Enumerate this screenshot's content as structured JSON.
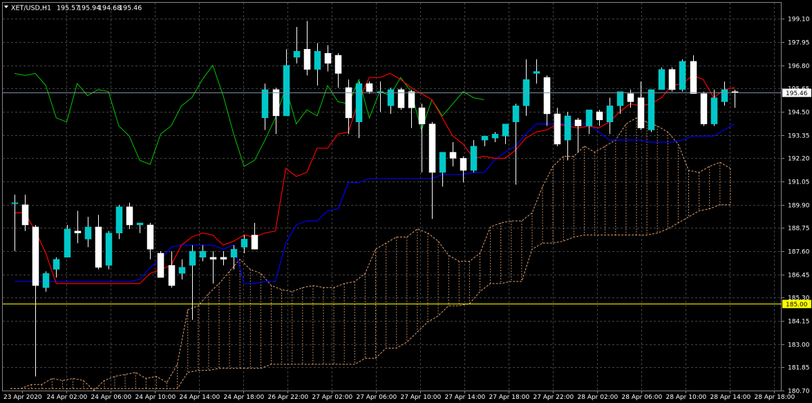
{
  "header": {
    "symbol": "XET/USD,H1",
    "open": "195.57",
    "high": "195.94",
    "low": "194.68",
    "close": "195.46"
  },
  "colors": {
    "background": "#000000",
    "grid": "#444444",
    "bull_candle": "#00c8c8",
    "bear_candle": "#ffffff",
    "tenkan": "#ff0000",
    "kijun": "#0000ff",
    "chikou": "#00c800",
    "cloud": "#e0a070",
    "bid_line": "#7f8fa0",
    "level_line": "#ffff00"
  },
  "chart_data": {
    "type": "candlestick",
    "symbol": "XET/USD",
    "timeframe": "H1",
    "ylim": [
      180.7,
      199.9
    ],
    "y_ticks": [
      "199.10",
      "197.95",
      "196.80",
      "195.65",
      "194.50",
      "193.35",
      "192.20",
      "191.05",
      "189.90",
      "188.75",
      "187.60",
      "186.45",
      "185.30",
      "184.15",
      "183.00",
      "181.85",
      "180.70"
    ],
    "x_ticks": [
      "23 Apr 2020",
      "24 Apr 02:00",
      "24 Apr 06:00",
      "24 Apr 10:00",
      "24 Apr 14:00",
      "24 Apr 18:00",
      "26 Apr 22:00",
      "27 Apr 02:00",
      "27 Apr 06:00",
      "27 Apr 10:00",
      "27 Apr 14:00",
      "27 Apr 18:00",
      "27 Apr 22:00",
      "28 Apr 02:00",
      "28 Apr 06:00",
      "28 Apr 10:00",
      "28 Apr 14:00",
      "28 Apr 18:00"
    ],
    "current_price": "195.46",
    "level_price": "185.00",
    "candles": [
      [
        190.0,
        190.4,
        187.6,
        190.0
      ],
      [
        189.9,
        190.4,
        188.6,
        188.9
      ],
      [
        188.8,
        188.9,
        181.4,
        185.9
      ],
      [
        185.8,
        186.6,
        185.6,
        186.5
      ],
      [
        186.7,
        187.3,
        186.3,
        187.2
      ],
      [
        187.3,
        188.9,
        187.3,
        188.7
      ],
      [
        188.6,
        189.6,
        188.0,
        188.5
      ],
      [
        188.2,
        189.3,
        187.8,
        188.8
      ],
      [
        188.8,
        189.4,
        186.7,
        186.8
      ],
      [
        186.9,
        188.6,
        186.7,
        188.5
      ],
      [
        188.5,
        189.9,
        188.2,
        189.8
      ],
      [
        189.8,
        190.0,
        188.7,
        188.9
      ],
      [
        188.9,
        189.0,
        188.5,
        189.0
      ],
      [
        188.9,
        189.0,
        187.2,
        187.7
      ],
      [
        187.5,
        187.6,
        186.5,
        186.3
      ],
      [
        186.9,
        187.6,
        185.8,
        185.9
      ],
      [
        186.5,
        187.2,
        186.2,
        186.8
      ],
      [
        186.9,
        187.9,
        184.2,
        187.6
      ],
      [
        187.3,
        187.9,
        187.1,
        187.6
      ],
      [
        187.3,
        187.6,
        186.0,
        187.2
      ],
      [
        187.3,
        187.6,
        186.9,
        187.2
      ],
      [
        187.3,
        187.9,
        186.7,
        187.7
      ],
      [
        187.8,
        188.4,
        187.5,
        188.2
      ],
      [
        188.4,
        189.0,
        187.7,
        187.7
      ],
      [
        194.2,
        195.9,
        193.6,
        195.6
      ],
      [
        195.6,
        195.7,
        193.4,
        194.3
      ],
      [
        194.3,
        197.6,
        194.3,
        196.8
      ],
      [
        197.2,
        198.7,
        196.9,
        197.5
      ],
      [
        197.6,
        199.0,
        196.3,
        196.6
      ],
      [
        196.6,
        197.9,
        195.8,
        197.5
      ],
      [
        197.4,
        197.8,
        196.5,
        196.9
      ],
      [
        197.3,
        197.4,
        195.7,
        196.4
      ],
      [
        195.7,
        196.1,
        193.4,
        194.2
      ],
      [
        194.0,
        196.0,
        193.2,
        195.9
      ],
      [
        195.9,
        196.0,
        195.4,
        195.5
      ],
      [
        195.5,
        196.0,
        194.5,
        195.5
      ],
      [
        194.8,
        195.7,
        194.4,
        195.6
      ],
      [
        195.6,
        195.7,
        194.6,
        194.7
      ],
      [
        195.5,
        195.6,
        193.7,
        194.7
      ],
      [
        194.7,
        194.9,
        191.5,
        193.9
      ],
      [
        193.9,
        194.0,
        189.2,
        191.5
      ],
      [
        191.5,
        192.5,
        190.8,
        192.5
      ],
      [
        192.5,
        193.0,
        191.8,
        192.2
      ],
      [
        192.2,
        192.3,
        191.0,
        191.6
      ],
      [
        191.6,
        193.1,
        191.5,
        192.8
      ],
      [
        193.1,
        193.3,
        192.8,
        193.3
      ],
      [
        193.2,
        193.5,
        193.0,
        193.4
      ],
      [
        193.3,
        193.9,
        192.9,
        193.9
      ],
      [
        194.0,
        194.9,
        190.9,
        194.8
      ],
      [
        194.8,
        197.1,
        194.3,
        196.1
      ],
      [
        196.4,
        197.1,
        195.9,
        196.5
      ],
      [
        196.2,
        196.3,
        193.8,
        194.4
      ],
      [
        194.4,
        194.7,
        192.8,
        192.9
      ],
      [
        193.1,
        194.5,
        192.1,
        194.3
      ],
      [
        194.1,
        194.2,
        192.5,
        193.8
      ],
      [
        193.8,
        194.6,
        193.4,
        194.6
      ],
      [
        194.5,
        194.6,
        193.8,
        194.1
      ],
      [
        194.0,
        195.2,
        193.4,
        194.8
      ],
      [
        194.8,
        195.5,
        194.4,
        195.5
      ],
      [
        195.4,
        195.6,
        194.7,
        195.0
      ],
      [
        195.2,
        196.0,
        193.6,
        193.7
      ],
      [
        193.6,
        195.4,
        193.5,
        195.6
      ],
      [
        195.6,
        196.7,
        195.6,
        196.6
      ],
      [
        196.6,
        196.7,
        195.5,
        195.6
      ],
      [
        195.6,
        197.1,
        195.5,
        197.0
      ],
      [
        197.0,
        197.3,
        195.4,
        195.4
      ],
      [
        195.4,
        195.5,
        193.8,
        193.9
      ],
      [
        193.9,
        195.6,
        193.8,
        195.2
      ],
      [
        195.0,
        196.0,
        194.8,
        195.6
      ],
      [
        195.5,
        195.6,
        194.7,
        195.46
      ]
    ],
    "tenkan": [
      189.5,
      189.5,
      188.6,
      187.5,
      186.0,
      186.0,
      186.0,
      186.0,
      186.0,
      186.0,
      186.0,
      186.0,
      186.0,
      186.5,
      186.7,
      186.9,
      187.9,
      188.3,
      188.5,
      188.4,
      187.9,
      188.1,
      188.4,
      188.3,
      188.5,
      188.6,
      191.7,
      191.3,
      191.5,
      192.7,
      192.7,
      193.4,
      193.5,
      195.1,
      196.2,
      196.2,
      196.4,
      196.1,
      195.7,
      195.4,
      195.1,
      194.2,
      193.3,
      192.9,
      192.2,
      192.3,
      192.2,
      192.2,
      192.6,
      193.2,
      193.5,
      193.6,
      193.9,
      193.8,
      193.7,
      193.8,
      193.7,
      194.0,
      194.5,
      194.9,
      194.8,
      194.9,
      195.2,
      195.8,
      195.9,
      196.3,
      196.1,
      195.2,
      195.6,
      195.7
    ],
    "kijun": [
      186.1,
      186.1,
      186.1,
      186.1,
      186.1,
      186.1,
      186.1,
      186.1,
      186.1,
      186.1,
      186.1,
      186.1,
      186.2,
      186.8,
      187.2,
      187.8,
      187.9,
      187.9,
      187.9,
      187.9,
      187.7,
      187.9,
      186.0,
      186.0,
      186.1,
      186.1,
      188.0,
      188.9,
      189.1,
      189.1,
      189.6,
      189.7,
      191.0,
      191.0,
      191.2,
      191.2,
      191.2,
      191.2,
      191.2,
      191.2,
      191.2,
      191.4,
      191.4,
      191.4,
      191.5,
      191.5,
      192.1,
      192.5,
      192.8,
      193.4,
      193.9,
      193.9,
      193.9,
      193.9,
      193.9,
      193.9,
      193.5,
      193.1,
      193.1,
      193.1,
      193.1,
      193.0,
      193.0,
      193.0,
      193.1,
      193.3,
      193.3,
      193.3,
      193.6,
      193.9
    ],
    "chikou": [
      196.4,
      196.3,
      196.4,
      195.8,
      194.2,
      194.0,
      195.9,
      195.3,
      195.6,
      195.5,
      193.8,
      193.3,
      192.1,
      191.9,
      193.4,
      193.8,
      194.8,
      195.2,
      196.1,
      196.8,
      195.3,
      193.4,
      191.8,
      192.1,
      193.1,
      194.2,
      195.7,
      193.9,
      194.6,
      194.3,
      195.8,
      195.0,
      194.9,
      196.1,
      194.2,
      195.5,
      195.3,
      196.2,
      195.5,
      193.6,
      195.1,
      194.3,
      194.9,
      195.5,
      195.2,
      195.1
    ],
    "senkou_a": [
      180.8,
      180.8,
      181.0,
      181.0,
      181.3,
      181.2,
      181.3,
      181.2,
      180.7,
      181.2,
      181.4,
      181.5,
      181.6,
      181.3,
      181.4,
      181.1,
      182.0,
      184.7,
      184.9,
      185.5,
      186.0,
      186.6,
      187.2,
      186.7,
      186.5,
      185.9,
      185.7,
      185.6,
      185.8,
      185.9,
      185.8,
      185.8,
      186.0,
      186.1,
      186.5,
      187.7,
      188.0,
      188.3,
      188.3,
      188.7,
      188.5,
      188.1,
      187.4,
      187.1,
      187.1,
      187.5,
      188.8,
      189.0,
      189.1,
      189.1,
      189.5,
      190.8,
      191.8,
      192.3,
      192.3,
      192.8,
      192.5,
      192.8,
      193.1,
      193.9,
      194.2,
      194.0,
      193.8,
      193.5,
      192.9,
      191.6,
      191.5,
      191.8,
      192.0,
      191.7
    ],
    "senkou_b": [
      180.8,
      180.8,
      180.8,
      180.8,
      180.8,
      180.8,
      180.8,
      180.8,
      180.8,
      180.8,
      180.8,
      180.8,
      180.8,
      180.8,
      180.8,
      180.8,
      180.8,
      181.6,
      181.7,
      181.7,
      181.8,
      181.8,
      181.8,
      181.8,
      181.8,
      182.0,
      182.0,
      182.0,
      182.0,
      182.0,
      182.0,
      182.0,
      182.0,
      182.0,
      182.3,
      182.3,
      182.8,
      182.8,
      183.1,
      183.6,
      184.1,
      184.4,
      184.9,
      184.9,
      185.0,
      185.6,
      186.0,
      186.0,
      186.1,
      186.1,
      187.7,
      188.0,
      188.0,
      188.1,
      188.3,
      188.4,
      188.4,
      188.4,
      188.4,
      188.4,
      188.4,
      188.4,
      188.5,
      188.7,
      189.0,
      189.3,
      189.6,
      189.7,
      189.9,
      189.9
    ]
  }
}
